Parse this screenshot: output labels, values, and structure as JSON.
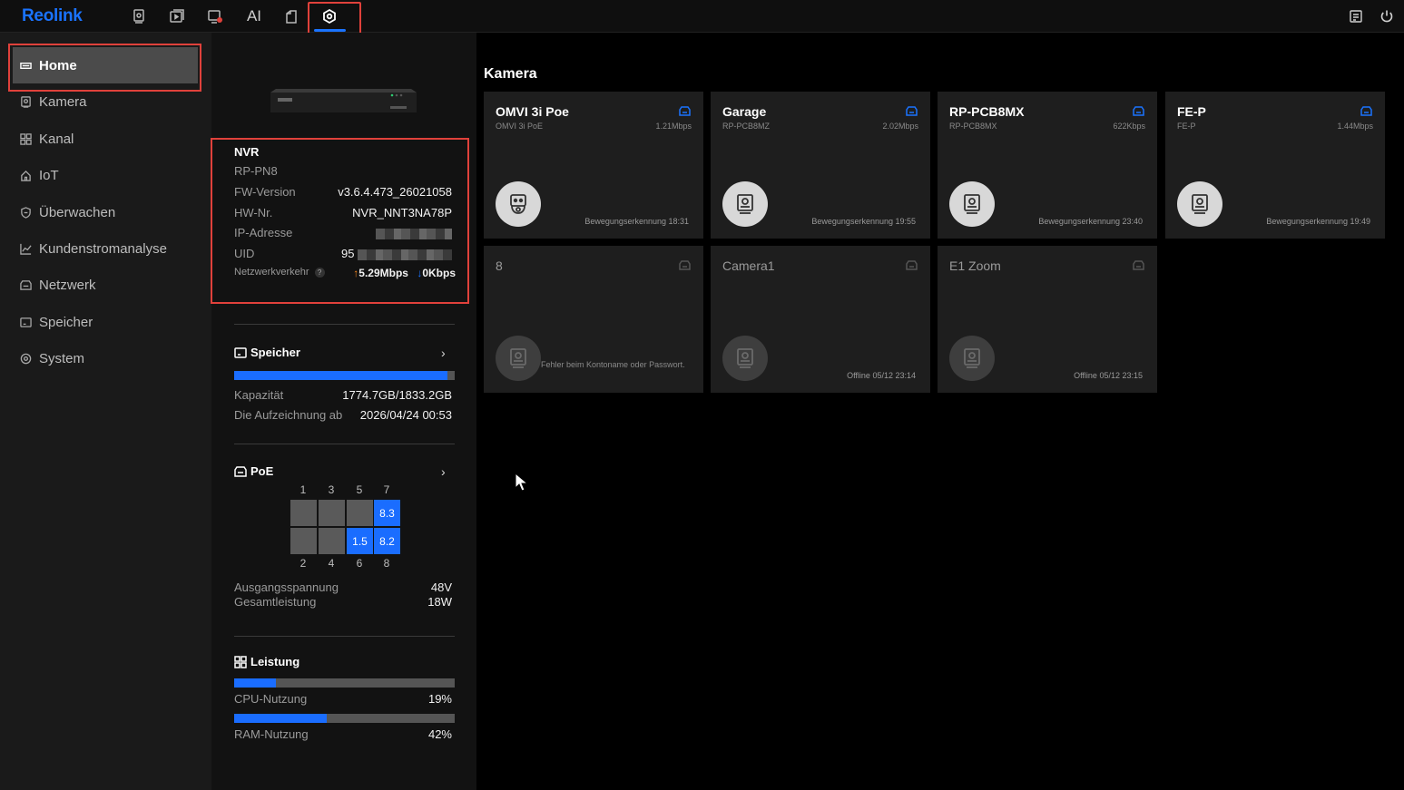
{
  "app": {
    "logo": "Reolink"
  },
  "topnav": {
    "items": [
      {
        "name": "live-view",
        "label": ""
      },
      {
        "name": "playback",
        "label": ""
      },
      {
        "name": "alarm",
        "label": ""
      },
      {
        "name": "ai",
        "label": "AI"
      },
      {
        "name": "files",
        "label": ""
      },
      {
        "name": "settings",
        "label": "",
        "active": true
      }
    ]
  },
  "sidebar": {
    "items": [
      {
        "label": "Home",
        "icon": "home-icon",
        "active": true
      },
      {
        "label": "Kamera",
        "icon": "camera-icon"
      },
      {
        "label": "Kanal",
        "icon": "grid-icon"
      },
      {
        "label": "IoT",
        "icon": "iot-icon"
      },
      {
        "label": "Überwachen",
        "icon": "shield-icon"
      },
      {
        "label": "Kundenstromanalyse",
        "icon": "chart-icon"
      },
      {
        "label": "Netzwerk",
        "icon": "network-icon"
      },
      {
        "label": "Speicher",
        "icon": "storage-icon"
      },
      {
        "label": "System",
        "icon": "system-icon"
      }
    ]
  },
  "device": {
    "title": "NVR",
    "model": "RP-PN8",
    "fw_label": "FW-Version",
    "fw_value": "v3.6.4.473_26021058",
    "hw_label": "HW-Nr.",
    "hw_value": "NVR_NNT3NA78P",
    "ip_label": "IP-Adresse",
    "uid_label": "UID",
    "uid_value": "95",
    "traffic_label": "Netzwerkverkehr",
    "traffic_help": "?",
    "upload": "5.29Mbps",
    "download": "0Kbps"
  },
  "storage": {
    "title": "Speicher",
    "fill": 0.968,
    "capacity_label": "Kapazität",
    "capacity_value": "1774.7GB/1833.2GB",
    "record_label": "Die Aufzeichnung ab",
    "record_value": "2026/04/24 00:53"
  },
  "poe": {
    "title": "PoE",
    "top_ports": [
      "1",
      "3",
      "5",
      "7"
    ],
    "bottom_ports": [
      "2",
      "4",
      "6",
      "8"
    ],
    "top_values": [
      "",
      "",
      "",
      "8.3"
    ],
    "bottom_values": [
      "",
      "",
      "1.5",
      "8.2"
    ],
    "voltage_label": "Ausgangsspannung",
    "voltage_value": "48V",
    "power_label": "Gesamtleistung",
    "power_value": "18W"
  },
  "performance": {
    "title": "Leistung",
    "cpu_label": "CPU-Nutzung",
    "cpu_value": "19%",
    "cpu_fill": 0.19,
    "ram_label": "RAM-Nutzung",
    "ram_value": "42%",
    "ram_fill": 0.42
  },
  "cameras": {
    "title": "Kamera",
    "list": [
      {
        "name": "OMVI 3i Poe",
        "model": "OMVI 3i PoE",
        "rate": "1.21Mbps",
        "event": "Bewegungserkennung 18:31",
        "online": true
      },
      {
        "name": "Garage",
        "model": "RP-PCB8MZ",
        "rate": "2.02Mbps",
        "event": "Bewegungserkennung 19:55",
        "online": true
      },
      {
        "name": "RP-PCB8MX",
        "model": "RP-PCB8MX",
        "rate": "622Kbps",
        "event": "Bewegungserkennung 23:40",
        "online": true
      },
      {
        "name": "FE-P",
        "model": "FE-P",
        "rate": "1.44Mbps",
        "event": "Bewegungserkennung 19:49",
        "online": true
      },
      {
        "name": "8",
        "error": "Fehler beim Kontoname oder Passwort.",
        "online": false
      },
      {
        "name": "Camera1",
        "event": "Offline 05/12 23:14",
        "online": false
      },
      {
        "name": "E1 Zoom",
        "event": "Offline 05/12 23:15",
        "online": false
      }
    ]
  }
}
